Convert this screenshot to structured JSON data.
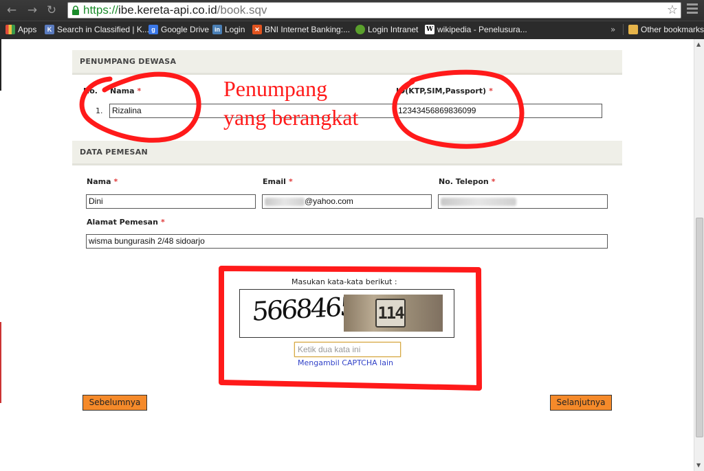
{
  "browser": {
    "url_scheme": "https://",
    "url_host": "ibe.kereta-api.co.id",
    "url_path": "/book.sqv",
    "bookmarks": [
      {
        "label": "Apps",
        "icon": "apps-icon",
        "color": "#e0b040"
      },
      {
        "label": "Search in Classified | K...",
        "icon": "classified-icon",
        "color": "#5a7bbf"
      },
      {
        "label": "Google Drive",
        "icon": "google-icon",
        "color": "#3b78e7"
      },
      {
        "label": "Login",
        "icon": "login-site-icon",
        "color": "#4a7fb5"
      },
      {
        "label": "BNI Internet Banking:...",
        "icon": "bni-icon",
        "color": "#e0531f"
      },
      {
        "label": "Login Intranet",
        "icon": "intranet-icon",
        "color": "#5aa02c"
      },
      {
        "label": "wikipedia - Penelusura...",
        "icon": "wikipedia-icon",
        "color": "#ffffff"
      }
    ],
    "more_glyph": "»",
    "other_bookmarks": "Other bookmarks"
  },
  "passenger": {
    "section_title": "PENUMPANG DEWASA",
    "col_no": "No.",
    "col_name": "Nama",
    "col_id": "ID(KTP,SIM,Passport)",
    "required_mark": "*",
    "rows": [
      {
        "no": "1.",
        "name": "Rizalina",
        "id_number": "12343456869836099"
      }
    ]
  },
  "booker": {
    "section_title": "DATA PEMESAN",
    "name_label": "Nama",
    "email_label": "Email",
    "phone_label": "No. Telepon",
    "address_label": "Alamat Pemesan",
    "name_value": "Dini",
    "email_value": "@yahoo.com",
    "address_value": "wisma bungurasih 2/48 sidoarjo"
  },
  "captcha": {
    "title": "Masukan kata-kata berikut :",
    "word": "5668465",
    "photo_word": "114",
    "input_placeholder": "Ketik dua kata ini",
    "refresh_link": "Mengambil CAPTCHA lain"
  },
  "buttons": {
    "prev": "Sebelumnya",
    "next": "Selanjutnya"
  },
  "annotation": {
    "line1": "Penumpang",
    "line2": "yang berangkat",
    "color": "#ff1a1a"
  }
}
